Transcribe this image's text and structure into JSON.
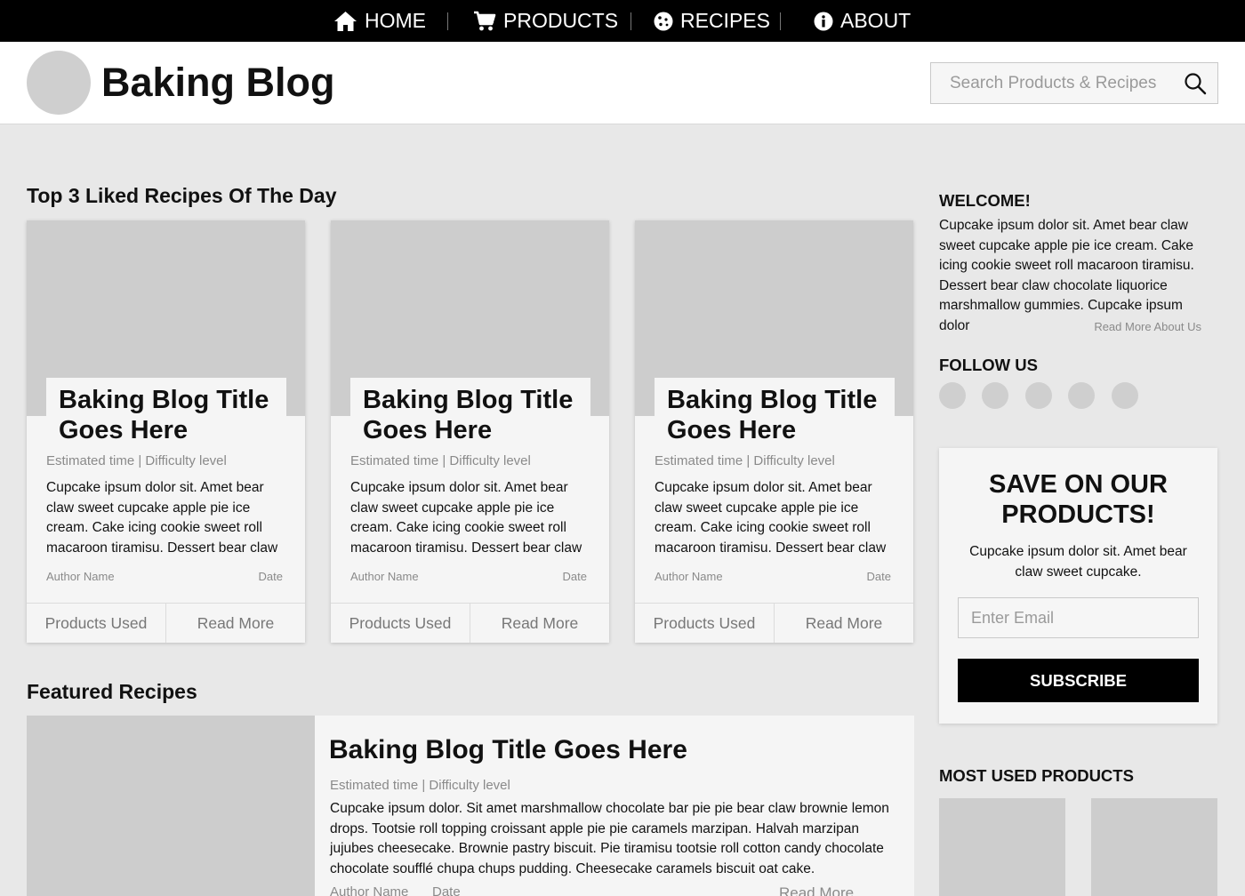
{
  "nav": {
    "items": [
      {
        "label": "HOME",
        "icon": "home-icon"
      },
      {
        "label": "PRODUCTS",
        "icon": "cart-icon"
      },
      {
        "label": "RECIPES",
        "icon": "cookie-icon"
      },
      {
        "label": "ABOUT",
        "icon": "info-icon"
      }
    ]
  },
  "header": {
    "title": "Baking Blog",
    "search_placeholder": "Search Products & Recipes"
  },
  "top_recipes": {
    "heading": "Top 3 Liked Recipes Of The Day",
    "cards": [
      {
        "title": "Baking Blog Title Goes Here",
        "meta": "Estimated time | Difficulty level",
        "description": "Cupcake ipsum dolor sit. Amet bear claw sweet cupcake apple pie ice cream. Cake icing cookie sweet roll macaroon tiramisu. Dessert bear claw",
        "author": "Author Name",
        "date": "Date",
        "products_label": "Products Used",
        "read_more_label": "Read More"
      },
      {
        "title": "Baking Blog Title Goes Here",
        "meta": "Estimated time | Difficulty level",
        "description": "Cupcake ipsum dolor sit. Amet bear claw sweet cupcake apple pie ice cream. Cake icing cookie sweet roll macaroon tiramisu. Dessert bear claw",
        "author": "Author Name",
        "date": "Date",
        "products_label": "Products Used",
        "read_more_label": "Read More"
      },
      {
        "title": "Baking Blog Title Goes Here",
        "meta": "Estimated time | Difficulty level",
        "description": "Cupcake ipsum dolor sit. Amet bear claw sweet cupcake apple pie ice cream. Cake icing cookie sweet roll macaroon tiramisu. Dessert bear claw",
        "author": "Author Name",
        "date": "Date",
        "products_label": "Products Used",
        "read_more_label": "Read More"
      }
    ]
  },
  "featured": {
    "heading": "Featured Recipes",
    "title": "Baking Blog Title Goes Here",
    "meta": "Estimated time | Difficulty level",
    "description": "Cupcake ipsum dolor. Sit amet marshmallow chocolate bar pie pie bear claw brownie lemon drops. Tootsie roll topping croissant apple pie pie caramels marzipan. Halvah marzipan jujubes cheesecake. Brownie pastry biscuit. Pie tiramisu tootsie roll cotton candy chocolate chocolate soufflé chupa chups pudding. Cheesecake caramels biscuit oat cake.",
    "author": "Author Name",
    "date": "Date",
    "read_more_label": "Read More"
  },
  "sidebar": {
    "welcome_heading": "WELCOME!",
    "welcome_text": "Cupcake ipsum dolor sit. Amet bear claw sweet cupcake apple pie ice cream. Cake icing cookie sweet roll macaroon tiramisu. Dessert bear claw chocolate liquorice marshmallow gummies. Cupcake ipsum dolor",
    "read_more_about": "Read More About Us",
    "follow_heading": "FOLLOW US",
    "promo": {
      "title": "SAVE ON OUR PRODUCTS!",
      "text": "Cupcake ipsum dolor sit. Amet bear claw sweet cupcake.",
      "email_placeholder": "Enter Email",
      "button_label": "SUBSCRIBE"
    },
    "products_heading": "MOST USED PRODUCTS"
  },
  "colors": {
    "nav_bg": "#000000",
    "page_bg": "#e8e8e8",
    "card_bg": "#f5f5f5",
    "placeholder_gray": "#cdcdcd",
    "muted_text": "#8a8a8a"
  }
}
